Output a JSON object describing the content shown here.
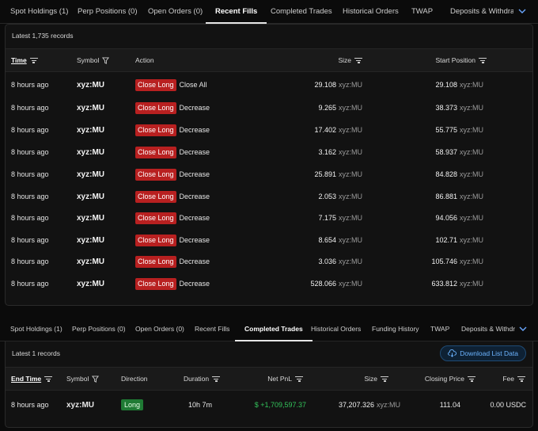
{
  "top_tabs": [
    {
      "label": "Spot Holdings (1)",
      "active": false
    },
    {
      "label": "Perp Positions (0)",
      "active": false
    },
    {
      "label": "Open Orders (0)",
      "active": false
    },
    {
      "label": "Recent Fills",
      "active": true
    },
    {
      "label": "Completed Trades",
      "active": false
    },
    {
      "label": "Historical Orders",
      "active": false
    },
    {
      "label": "TWAP",
      "active": false
    },
    {
      "label": "Deposits & Withdrawals",
      "active": false
    }
  ],
  "fills": {
    "records_label": "Latest 1,735 records",
    "columns": {
      "time": "Time",
      "symbol": "Symbol",
      "action": "Action",
      "size": "Size",
      "start_position": "Start Position"
    },
    "rows": [
      {
        "time": "8 hours ago",
        "symbol": "xyz:MU",
        "badge": "Close Long",
        "action": "Close All",
        "size": "29.108",
        "size_unit": "xyz:MU",
        "start": "29.108",
        "start_unit": "xyz:MU"
      },
      {
        "time": "8 hours ago",
        "symbol": "xyz:MU",
        "badge": "Close Long",
        "action": "Decrease",
        "size": "9.265",
        "size_unit": "xyz:MU",
        "start": "38.373",
        "start_unit": "xyz:MU"
      },
      {
        "time": "8 hours ago",
        "symbol": "xyz:MU",
        "badge": "Close Long",
        "action": "Decrease",
        "size": "17.402",
        "size_unit": "xyz:MU",
        "start": "55.775",
        "start_unit": "xyz:MU"
      },
      {
        "time": "8 hours ago",
        "symbol": "xyz:MU",
        "badge": "Close Long",
        "action": "Decrease",
        "size": "3.162",
        "size_unit": "xyz:MU",
        "start": "58.937",
        "start_unit": "xyz:MU"
      },
      {
        "time": "8 hours ago",
        "symbol": "xyz:MU",
        "badge": "Close Long",
        "action": "Decrease",
        "size": "25.891",
        "size_unit": "xyz:MU",
        "start": "84.828",
        "start_unit": "xyz:MU"
      },
      {
        "time": "8 hours ago",
        "symbol": "xyz:MU",
        "badge": "Close Long",
        "action": "Decrease",
        "size": "2.053",
        "size_unit": "xyz:MU",
        "start": "86.881",
        "start_unit": "xyz:MU"
      },
      {
        "time": "8 hours ago",
        "symbol": "xyz:MU",
        "badge": "Close Long",
        "action": "Decrease",
        "size": "7.175",
        "size_unit": "xyz:MU",
        "start": "94.056",
        "start_unit": "xyz:MU"
      },
      {
        "time": "8 hours ago",
        "symbol": "xyz:MU",
        "badge": "Close Long",
        "action": "Decrease",
        "size": "8.654",
        "size_unit": "xyz:MU",
        "start": "102.71",
        "start_unit": "xyz:MU"
      },
      {
        "time": "8 hours ago",
        "symbol": "xyz:MU",
        "badge": "Close Long",
        "action": "Decrease",
        "size": "3.036",
        "size_unit": "xyz:MU",
        "start": "105.746",
        "start_unit": "xyz:MU"
      },
      {
        "time": "8 hours ago",
        "symbol": "xyz:MU",
        "badge": "Close Long",
        "action": "Decrease",
        "size": "528.066",
        "size_unit": "xyz:MU",
        "start": "633.812",
        "start_unit": "xyz:MU"
      }
    ]
  },
  "bottom_tabs": [
    {
      "label": "Spot Holdings (1)",
      "active": false
    },
    {
      "label": "Perp Positions (0)",
      "active": false
    },
    {
      "label": "Open Orders (0)",
      "active": false
    },
    {
      "label": "Recent Fills",
      "active": false
    },
    {
      "label": "Completed Trades",
      "active": true
    },
    {
      "label": "Historical Orders",
      "active": false
    },
    {
      "label": "Funding History",
      "active": false
    },
    {
      "label": "TWAP",
      "active": false
    },
    {
      "label": "Deposits & Withdrawals",
      "active": false
    }
  ],
  "trades": {
    "records_label": "Latest 1 records",
    "download_label": "Download List Data",
    "columns": {
      "end_time": "End Time",
      "symbol": "Symbol",
      "direction": "Direction",
      "duration": "Duration",
      "net_pnl": "Net PnL",
      "size": "Size",
      "closing_price": "Closing Price",
      "fee": "Fee"
    },
    "row": {
      "end_time": "8 hours ago",
      "symbol": "xyz:MU",
      "direction": "Long",
      "duration": "10h 7m",
      "net_pnl": "$ +1,709,597.37",
      "size": "37,207.326",
      "size_unit": "xyz:MU",
      "closing_price": "111.04",
      "fee": "0.00 USDC"
    }
  },
  "colors": {
    "close_badge": "#b82020",
    "long_badge": "#1f7a34",
    "pnl_positive": "#33c35b",
    "accent": "#6cb4ff"
  },
  "icons": {
    "sort": "sort-lines-icon",
    "filter": "funnel-icon",
    "more_tabs": "chevron-down-icon",
    "download": "cloud-download-icon"
  }
}
